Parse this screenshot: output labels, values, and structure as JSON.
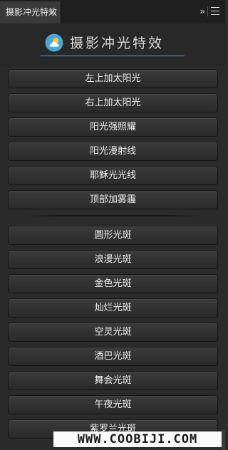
{
  "panel": {
    "tab_title": "摄影冲光特效",
    "tab_close": "×",
    "expand_glyph": "››"
  },
  "header": {
    "title": "摄影冲光特效",
    "accent_color": "#3aa8d8"
  },
  "group1": [
    {
      "label": "左上加太阳光"
    },
    {
      "label": "右上加太阳光"
    },
    {
      "label": "阳光强照耀"
    },
    {
      "label": "阳光漫射线"
    },
    {
      "label": "耶稣光光线"
    },
    {
      "label": "顶部加雾霾"
    }
  ],
  "group2": [
    {
      "label": "圆形光斑"
    },
    {
      "label": "浪漫光斑"
    },
    {
      "label": "金色光斑"
    },
    {
      "label": "灿烂光斑"
    },
    {
      "label": "空灵光斑"
    },
    {
      "label": "酒巴光斑"
    },
    {
      "label": "舞会光斑"
    },
    {
      "label": "午夜光斑"
    },
    {
      "label": "紫罗兰光斑"
    }
  ],
  "watermark": {
    "text": "WWW.COOBIJI.COM"
  }
}
